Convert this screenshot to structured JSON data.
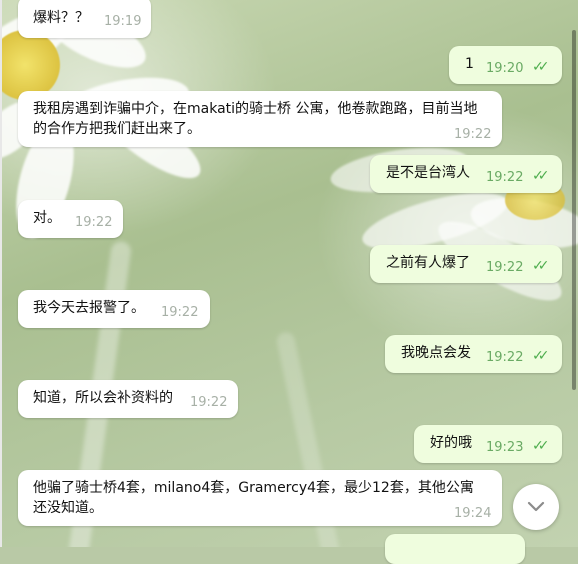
{
  "messages": [
    {
      "text": "爆料？？",
      "time": "19:19",
      "dir": "in"
    },
    {
      "text": "1",
      "time": "19:20",
      "dir": "out"
    },
    {
      "line1": "我租房遇到诈骗中介，在makati的骑士桥 公寓，他卷款跑路，目前当地",
      "line2": "的合作方把我们赶出来了。",
      "time": "19:22",
      "dir": "in"
    },
    {
      "text": "是不是台湾人",
      "time": "19:22",
      "dir": "out"
    },
    {
      "text": "对。",
      "time": "19:22",
      "dir": "in"
    },
    {
      "text": "之前有人爆了",
      "time": "19:22",
      "dir": "out"
    },
    {
      "text": "我今天去报警了。",
      "time": "19:22",
      "dir": "in"
    },
    {
      "text": "我晚点会发",
      "time": "19:22",
      "dir": "out"
    },
    {
      "text": "知道，所以会补资料的",
      "time": "19:22",
      "dir": "in"
    },
    {
      "text": "好的哦",
      "time": "19:23",
      "dir": "out"
    },
    {
      "line1": "他骗了骑士桥4套，milano4套，Gramercy4套，最少12套，其他公寓",
      "line2": "还没知道。",
      "time": "19:24",
      "dir": "in"
    }
  ],
  "colors": {
    "incoming": "#ffffff",
    "outgoing": "#effdde",
    "check": "#4fae4e"
  },
  "icons": {
    "read": "double-check-icon",
    "scroll": "chevron-down-icon"
  }
}
